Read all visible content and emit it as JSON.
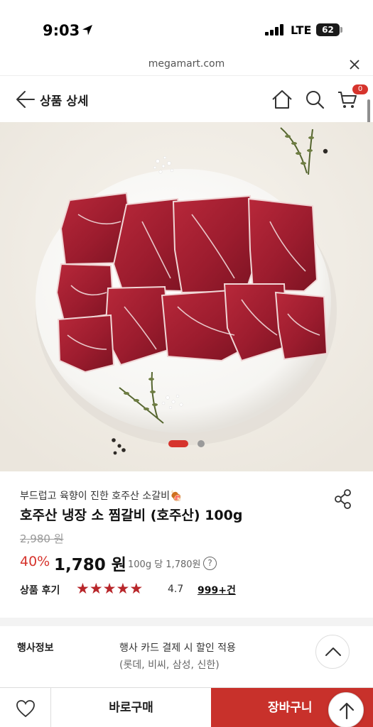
{
  "status_bar": {
    "time": "9:03",
    "network": "LTE",
    "battery": "62"
  },
  "browser": {
    "url": "megamart.com"
  },
  "header": {
    "title": "상품 상세",
    "cart_count": "0"
  },
  "carousel": {
    "active_index": 0,
    "total": 2
  },
  "product": {
    "subtitle": "부드럽고 육향이 진한 호주산 소갈비🍖",
    "name": "호주산 냉장 소 찜갈비 (호주산) 100g",
    "original_price": "2,980 원",
    "discount": "40%",
    "sale_price": "1,780 원",
    "unit_price": "100g 당 1,780원",
    "help": "?"
  },
  "reviews": {
    "label": "상품 후기",
    "rating": "4.7",
    "rating_value": 4.7,
    "count": "999+건"
  },
  "event": {
    "label": "행사정보",
    "line1": "행사 카드 결제 시 할인 적용",
    "line2": "(롯데, 비씨, 삼성, 신한)"
  },
  "bottom": {
    "buy_now": "바로구매",
    "add_to_cart": "장바구니"
  },
  "colors": {
    "accent": "#c8312b",
    "discount": "#d6342d",
    "star": "#b8262a"
  }
}
